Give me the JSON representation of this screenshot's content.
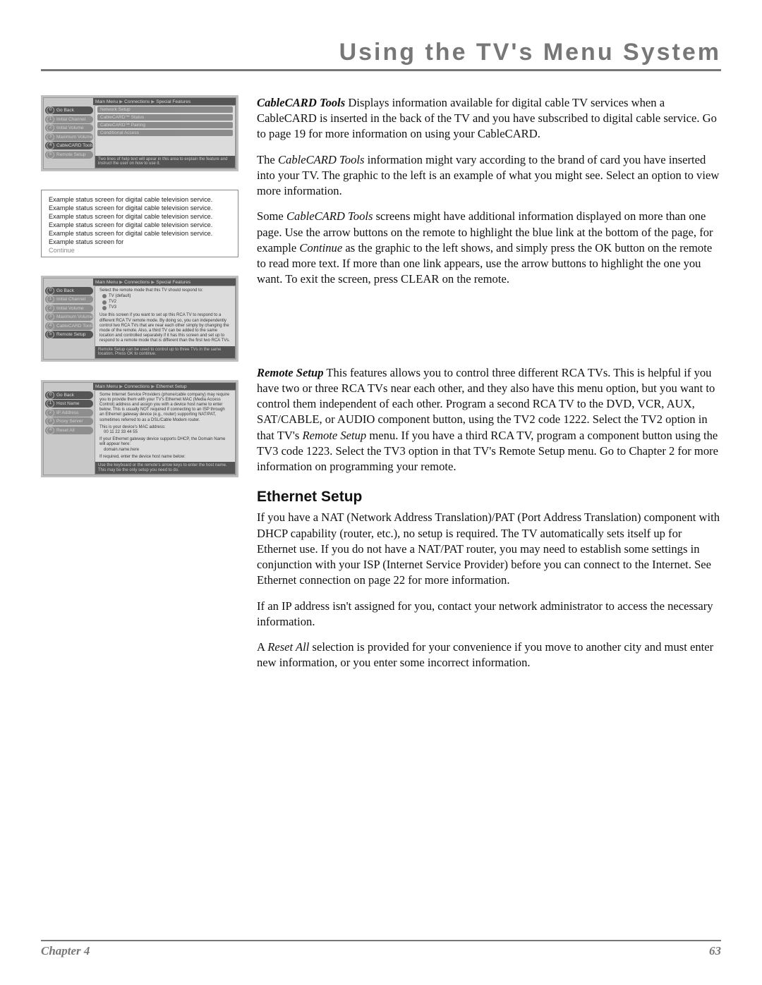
{
  "header": {
    "title": "Using the TV's Menu System"
  },
  "menuBox1": {
    "crumb": [
      "Main Menu",
      "Connections",
      "Special Features"
    ],
    "side": [
      {
        "num": "0",
        "label": "Go Back"
      },
      {
        "num": "1",
        "label": "Initial Channel"
      },
      {
        "num": "2",
        "label": "Initial Volume"
      },
      {
        "num": "3",
        "label": "Maximum Volume"
      },
      {
        "num": "4",
        "label": "CableCARD Tools"
      },
      {
        "num": "5",
        "label": "Remote Setup"
      }
    ],
    "pills": [
      "Network Setup",
      "CableCARD™ Status",
      "CableCARD™ Pairing",
      "Conditional Access"
    ],
    "help": "Two lines of help text will apear in this area to explain the feature and instruct the user on how to use it."
  },
  "statusBox": {
    "line": "Example status screen for digital cable television service.",
    "repeat": 5,
    "tail": "Example status screen for",
    "continue": "Continue"
  },
  "menuBox2": {
    "crumb": [
      "Main Menu",
      "Connections",
      "Special Features"
    ],
    "side": [
      {
        "num": "0",
        "label": "Go Back"
      },
      {
        "num": "1",
        "label": "Initial Channel"
      },
      {
        "num": "2",
        "label": "Initial Volume"
      },
      {
        "num": "3",
        "label": "Maximum Volume"
      },
      {
        "num": "4",
        "label": "CableCARD Tools"
      },
      {
        "num": "5",
        "label": "Remote Setup"
      }
    ],
    "panel_top": "Select the remote mode that this TV should respond to:",
    "radios": [
      "TV (default)",
      "TV2",
      "TV3"
    ],
    "panel_body": "Use this screen if you want to set up this RCA TV to respond to a different RCA TV remote mode. By doing so, you can independently control two RCA TVs that are near each other simply by changing the mode of the remote. Also, a third TV can be added to the same location and controlled separately if it has this screen and set up to respond to a remote mode that is different than the first two RCA TVs.",
    "help": "Remote Setup can be used to control up to three TVs in the same location. Press OK to continue."
  },
  "menuBox3": {
    "crumb": [
      "Main Menu",
      "Connections",
      "Ethernet Setup"
    ],
    "side": [
      {
        "num": "0",
        "label": "Go Back"
      },
      {
        "num": "1",
        "label": "Host Name"
      },
      {
        "num": "2",
        "label": "IP Address"
      },
      {
        "num": "3",
        "label": "Proxy Server"
      },
      {
        "num": "4",
        "label": "Reset All"
      }
    ],
    "panel_body1": "Some Internet Service Providers (phone/cable company) may require you to provide them with your TV's Ethernet MAC (Media Access Control) address and assign you with a device host name to enter below. This is usually NOT required if connecting to an ISP through an Ethernet gateway device (e.g., router) supporting NAT/PAT, sometimes referred to as a DSL/Cable Modem router.",
    "panel_mac_lbl": "This is your device's MAC address:",
    "panel_mac": "00 11 22 33 44 55",
    "panel_dhcp": "If your Ethernet gateway device supports DHCP, the Domain Name will appear here:",
    "panel_domain": "domain.name.here",
    "panel_host": "If required, enter the device host name below:",
    "help": "Use the keyboard or the remote's arrow keys to enter the host name. This may be the only setup you need to do."
  },
  "body": {
    "p1_lead": "CableCARD Tools",
    "p1": "   Displays information available for digital cable TV services when a CableCARD is inserted in the back of the TV and you have subscribed to digital cable service. Go to page 19 for more information on using your CableCARD.",
    "p2_a": "The ",
    "p2_i": "CableCARD Tools",
    "p2_b": " information might vary according to the brand of card you have inserted into your TV. The graphic to the left is an example of what you might see. Select an option to view more information.",
    "p3_a": "Some ",
    "p3_i": "CableCARD Tools",
    "p3_b": " screens might have additional information displayed on more than one page. Use the arrow buttons on the remote to highlight the blue link at the bottom of the page, for example ",
    "p3_i2": "Continue",
    "p3_c": " as the graphic to the left shows, and simply press the OK button on the remote to read more text. If more than one link appears, use the arrow buttons to highlight the one you want. To exit the screen, press CLEAR on the remote.",
    "p4_lead": "Remote Setup",
    "p4": "   This features allows you to control three different RCA TVs. This is helpful if you have two or three RCA TVs near each other, and they also have this menu option, but you want to control them independent of each other. Program a second RCA TV to the DVD, VCR, AUX, SAT/CABLE, or AUDIO component button, using the TV2 code 1222. Select the TV2 option in that TV's ",
    "p4_i": "Remote Setup",
    "p4_b": " menu. If you have a third RCA TV, program a component button using the TV3 code 1223.  Select the TV3 option in that TV's Remote Setup menu. Go to Chapter 2 for more information on programming your remote.",
    "h2": "Ethernet Setup",
    "p5": "If you have a NAT (Network Address Translation)/PAT (Port Address Translation) component with DHCP capability (router, etc.), no setup is required. The TV automatically sets itself up for Ethernet use. If you do not have a NAT/PAT router, you may need to establish some settings in conjunction with your ISP (Internet Service Provider) before you can connect to the Internet. See Ethernet connection on page 22 for more information.",
    "p6": "If an IP address isn't assigned for you, contact your network administrator to access the necessary information.",
    "p7_a": "A ",
    "p7_i": "Reset All",
    "p7_b": " selection is provided for your convenience if you move to another city and must enter new information, or you enter some incorrect information."
  },
  "footer": {
    "chapter": "Chapter 4",
    "page": "63"
  }
}
